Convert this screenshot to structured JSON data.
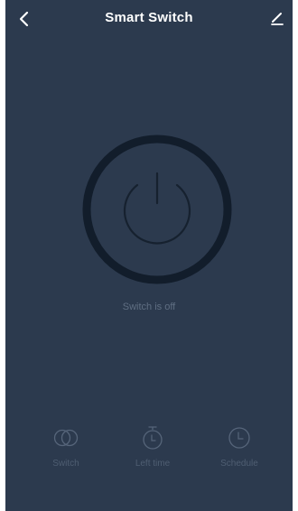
{
  "header": {
    "title": "Smart Switch",
    "back_icon": "chevron-left-icon",
    "edit_icon": "pencil-icon"
  },
  "power": {
    "icon": "power-icon",
    "state": "off"
  },
  "status": {
    "text": "Switch is off"
  },
  "tabs": [
    {
      "label": "Switch",
      "icon": "toggle-circles-icon"
    },
    {
      "label": "Left time",
      "icon": "stopwatch-icon"
    },
    {
      "label": "Schedule",
      "icon": "clock-icon"
    }
  ],
  "colors": {
    "background": "#2c3a4e",
    "ring": "#121d2b",
    "power_glyph": "#16212f",
    "title": "#ffffff",
    "muted_text": "#5f6e82",
    "tab_icon": "#56657a"
  }
}
